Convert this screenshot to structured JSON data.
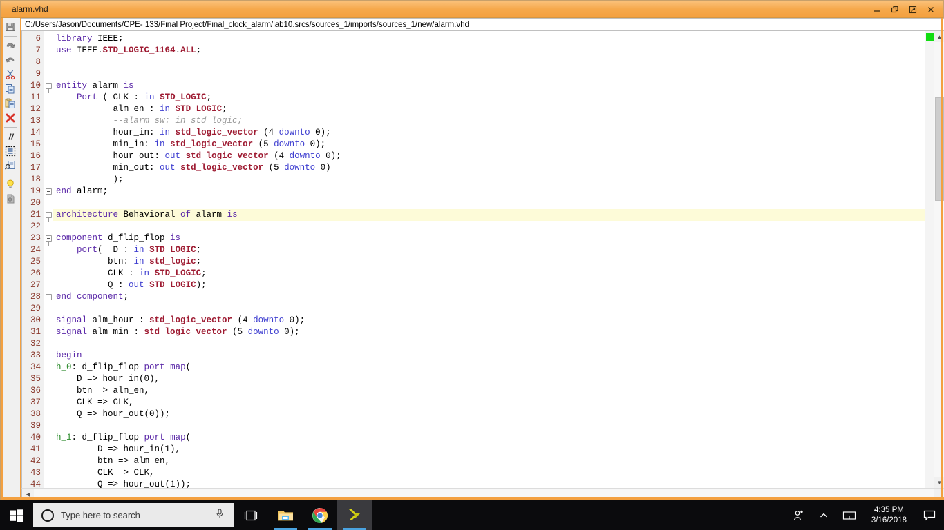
{
  "window": {
    "tab_title": "alarm.vhd",
    "file_path": "C:/Users/Jason/Documents/CPE- 133/Final Project/Final_clock_alarm/lab10.srcs/sources_1/imports/sources_1/new/alarm.vhd",
    "controls": {
      "minimize": "minimize-icon",
      "restore": "restore-icon",
      "float": "float-icon",
      "close": "close-icon"
    },
    "accent_color": "#f3a040",
    "titlebar_color": "#f6a94c"
  },
  "left_toolbar": {
    "items": [
      {
        "name": "save-icon",
        "title": "Save File"
      },
      {
        "name": "undo-icon",
        "title": "Undo"
      },
      {
        "name": "redo-icon",
        "title": "Redo"
      },
      {
        "name": "cut-icon",
        "title": "Cut"
      },
      {
        "name": "copy-icon",
        "title": "Copy"
      },
      {
        "name": "paste-icon",
        "title": "Paste"
      },
      {
        "name": "delete-x-icon",
        "title": "Delete"
      },
      {
        "name": "comment-slashes-icon",
        "title": "Toggle Comment"
      },
      {
        "name": "select-block-icon",
        "title": "Select Block"
      },
      {
        "name": "find-replace-icon",
        "title": "Find / Replace"
      },
      {
        "name": "lightbulb-icon",
        "title": "Suggestions"
      },
      {
        "name": "unknown-tool-icon",
        "title": "More"
      }
    ]
  },
  "editor": {
    "current_line": 21,
    "first_visible_line": 6,
    "colors": {
      "keyword": "#5b29a8",
      "type": "#9e1b32",
      "direction": "#3f3fd0",
      "comment": "#9a9a9a",
      "label": "#2c8b2c",
      "line_number": "#8b3a2e",
      "current_line_bg": "#fdfbd8",
      "marker_green": "#11dd11"
    },
    "lines": [
      {
        "n": 6,
        "fold": null,
        "tokens": [
          {
            "t": "library",
            "c": "kw"
          },
          {
            "t": " IEEE;",
            "c": "pl"
          }
        ]
      },
      {
        "n": 7,
        "fold": null,
        "tokens": [
          {
            "t": "use",
            "c": "kw"
          },
          {
            "t": " IEEE.",
            "c": "pl"
          },
          {
            "t": "STD_LOGIC_1164",
            "c": "typ"
          },
          {
            "t": ".",
            "c": "pl"
          },
          {
            "t": "ALL",
            "c": "typ"
          },
          {
            "t": ";",
            "c": "pl"
          }
        ]
      },
      {
        "n": 8,
        "fold": null,
        "tokens": []
      },
      {
        "n": 9,
        "fold": null,
        "tokens": []
      },
      {
        "n": 10,
        "fold": "open",
        "tokens": [
          {
            "t": "entity",
            "c": "kw"
          },
          {
            "t": " alarm ",
            "c": "pl"
          },
          {
            "t": "is",
            "c": "kw"
          }
        ]
      },
      {
        "n": 11,
        "fold": null,
        "tokens": [
          {
            "t": "    ",
            "c": "pl"
          },
          {
            "t": "Port",
            "c": "kw"
          },
          {
            "t": " ( CLK : ",
            "c": "pl"
          },
          {
            "t": "in",
            "c": "dir"
          },
          {
            "t": " ",
            "c": "pl"
          },
          {
            "t": "STD_LOGIC",
            "c": "typ"
          },
          {
            "t": ";",
            "c": "pl"
          }
        ]
      },
      {
        "n": 12,
        "fold": null,
        "tokens": [
          {
            "t": "           alm_en : ",
            "c": "pl"
          },
          {
            "t": "in",
            "c": "dir"
          },
          {
            "t": " ",
            "c": "pl"
          },
          {
            "t": "STD_LOGIC",
            "c": "typ"
          },
          {
            "t": ";",
            "c": "pl"
          }
        ]
      },
      {
        "n": 13,
        "fold": null,
        "tokens": [
          {
            "t": "           --alarm_sw: in std_logic;",
            "c": "cmt"
          }
        ]
      },
      {
        "n": 14,
        "fold": null,
        "tokens": [
          {
            "t": "           hour_in: ",
            "c": "pl"
          },
          {
            "t": "in",
            "c": "dir"
          },
          {
            "t": " ",
            "c": "pl"
          },
          {
            "t": "std_logic_vector",
            "c": "typ"
          },
          {
            "t": " (4 ",
            "c": "pl"
          },
          {
            "t": "downto",
            "c": "dir"
          },
          {
            "t": " 0);",
            "c": "pl"
          }
        ]
      },
      {
        "n": 15,
        "fold": null,
        "tokens": [
          {
            "t": "           min_in: ",
            "c": "pl"
          },
          {
            "t": "in",
            "c": "dir"
          },
          {
            "t": " ",
            "c": "pl"
          },
          {
            "t": "std_logic_vector",
            "c": "typ"
          },
          {
            "t": " (5 ",
            "c": "pl"
          },
          {
            "t": "downto",
            "c": "dir"
          },
          {
            "t": " 0);",
            "c": "pl"
          }
        ]
      },
      {
        "n": 16,
        "fold": null,
        "tokens": [
          {
            "t": "           hour_out: ",
            "c": "pl"
          },
          {
            "t": "out",
            "c": "dir"
          },
          {
            "t": " ",
            "c": "pl"
          },
          {
            "t": "std_logic_vector",
            "c": "typ"
          },
          {
            "t": " (4 ",
            "c": "pl"
          },
          {
            "t": "downto",
            "c": "dir"
          },
          {
            "t": " 0);",
            "c": "pl"
          }
        ]
      },
      {
        "n": 17,
        "fold": null,
        "tokens": [
          {
            "t": "           min_out: ",
            "c": "pl"
          },
          {
            "t": "out",
            "c": "dir"
          },
          {
            "t": " ",
            "c": "pl"
          },
          {
            "t": "std_logic_vector",
            "c": "typ"
          },
          {
            "t": " (5 ",
            "c": "pl"
          },
          {
            "t": "downto",
            "c": "dir"
          },
          {
            "t": " 0)",
            "c": "pl"
          }
        ]
      },
      {
        "n": 18,
        "fold": null,
        "tokens": [
          {
            "t": "           );",
            "c": "pl"
          }
        ]
      },
      {
        "n": 19,
        "fold": "close",
        "tokens": [
          {
            "t": "end",
            "c": "kw"
          },
          {
            "t": " alarm;",
            "c": "pl"
          }
        ]
      },
      {
        "n": 20,
        "fold": null,
        "tokens": []
      },
      {
        "n": 21,
        "fold": "open",
        "tokens": [
          {
            "t": "architecture",
            "c": "kw"
          },
          {
            "t": " Behavioral ",
            "c": "pl"
          },
          {
            "t": "of",
            "c": "kw"
          },
          {
            "t": " alarm ",
            "c": "pl"
          },
          {
            "t": "is",
            "c": "kw"
          }
        ]
      },
      {
        "n": 22,
        "fold": null,
        "tokens": []
      },
      {
        "n": 23,
        "fold": "open",
        "tokens": [
          {
            "t": "component",
            "c": "kw"
          },
          {
            "t": " d_flip_flop ",
            "c": "pl"
          },
          {
            "t": "is",
            "c": "kw"
          }
        ]
      },
      {
        "n": 24,
        "fold": null,
        "tokens": [
          {
            "t": "    ",
            "c": "pl"
          },
          {
            "t": "port",
            "c": "kw"
          },
          {
            "t": "(  D : ",
            "c": "pl"
          },
          {
            "t": "in",
            "c": "dir"
          },
          {
            "t": " ",
            "c": "pl"
          },
          {
            "t": "STD_LOGIC",
            "c": "typ"
          },
          {
            "t": ";",
            "c": "pl"
          }
        ]
      },
      {
        "n": 25,
        "fold": null,
        "tokens": [
          {
            "t": "          btn: ",
            "c": "pl"
          },
          {
            "t": "in",
            "c": "dir"
          },
          {
            "t": " ",
            "c": "pl"
          },
          {
            "t": "std_logic",
            "c": "typ"
          },
          {
            "t": ";",
            "c": "pl"
          }
        ]
      },
      {
        "n": 26,
        "fold": null,
        "tokens": [
          {
            "t": "          CLK : ",
            "c": "pl"
          },
          {
            "t": "in",
            "c": "dir"
          },
          {
            "t": " ",
            "c": "pl"
          },
          {
            "t": "STD_LOGIC",
            "c": "typ"
          },
          {
            "t": ";",
            "c": "pl"
          }
        ]
      },
      {
        "n": 27,
        "fold": null,
        "tokens": [
          {
            "t": "          Q : ",
            "c": "pl"
          },
          {
            "t": "out",
            "c": "dir"
          },
          {
            "t": " ",
            "c": "pl"
          },
          {
            "t": "STD_LOGIC",
            "c": "typ"
          },
          {
            "t": ");",
            "c": "pl"
          }
        ]
      },
      {
        "n": 28,
        "fold": "close",
        "tokens": [
          {
            "t": "end",
            "c": "kw"
          },
          {
            "t": " ",
            "c": "pl"
          },
          {
            "t": "component",
            "c": "kw"
          },
          {
            "t": ";",
            "c": "pl"
          }
        ]
      },
      {
        "n": 29,
        "fold": null,
        "tokens": []
      },
      {
        "n": 30,
        "fold": null,
        "tokens": [
          {
            "t": "signal",
            "c": "kw"
          },
          {
            "t": " alm_hour : ",
            "c": "pl"
          },
          {
            "t": "std_logic_vector",
            "c": "typ"
          },
          {
            "t": " (4 ",
            "c": "pl"
          },
          {
            "t": "downto",
            "c": "dir"
          },
          {
            "t": " 0);",
            "c": "pl"
          }
        ]
      },
      {
        "n": 31,
        "fold": null,
        "tokens": [
          {
            "t": "signal",
            "c": "kw"
          },
          {
            "t": " alm_min : ",
            "c": "pl"
          },
          {
            "t": "std_logic_vector",
            "c": "typ"
          },
          {
            "t": " (5 ",
            "c": "pl"
          },
          {
            "t": "downto",
            "c": "dir"
          },
          {
            "t": " 0);",
            "c": "pl"
          }
        ]
      },
      {
        "n": 32,
        "fold": null,
        "tokens": []
      },
      {
        "n": 33,
        "fold": null,
        "tokens": [
          {
            "t": "begin",
            "c": "kw"
          }
        ]
      },
      {
        "n": 34,
        "fold": null,
        "tokens": [
          {
            "t": "h_0",
            "c": "lbl"
          },
          {
            "t": ": d_flip_flop ",
            "c": "pl"
          },
          {
            "t": "port",
            "c": "kw"
          },
          {
            "t": " ",
            "c": "pl"
          },
          {
            "t": "map",
            "c": "kw"
          },
          {
            "t": "(",
            "c": "pl"
          }
        ]
      },
      {
        "n": 35,
        "fold": null,
        "tokens": [
          {
            "t": "    D => hour_in(0),",
            "c": "pl"
          }
        ]
      },
      {
        "n": 36,
        "fold": null,
        "tokens": [
          {
            "t": "    btn => alm_en,",
            "c": "pl"
          }
        ]
      },
      {
        "n": 37,
        "fold": null,
        "tokens": [
          {
            "t": "    CLK => CLK,",
            "c": "pl"
          }
        ]
      },
      {
        "n": 38,
        "fold": null,
        "tokens": [
          {
            "t": "    Q => hour_out(0));",
            "c": "pl"
          }
        ]
      },
      {
        "n": 39,
        "fold": null,
        "tokens": []
      },
      {
        "n": 40,
        "fold": null,
        "tokens": [
          {
            "t": "h_1",
            "c": "lbl"
          },
          {
            "t": ": d_flip_flop ",
            "c": "pl"
          },
          {
            "t": "port",
            "c": "kw"
          },
          {
            "t": " ",
            "c": "pl"
          },
          {
            "t": "map",
            "c": "kw"
          },
          {
            "t": "(",
            "c": "pl"
          }
        ]
      },
      {
        "n": 41,
        "fold": null,
        "tokens": [
          {
            "t": "        D => hour_in(1),",
            "c": "pl"
          }
        ]
      },
      {
        "n": 42,
        "fold": null,
        "tokens": [
          {
            "t": "        btn => alm_en,",
            "c": "pl"
          }
        ]
      },
      {
        "n": 43,
        "fold": null,
        "tokens": [
          {
            "t": "        CLK => CLK,",
            "c": "pl"
          }
        ]
      },
      {
        "n": 44,
        "fold": null,
        "tokens": [
          {
            "t": "        Q => hour_out(1));",
            "c": "pl"
          }
        ]
      }
    ]
  },
  "taskbar": {
    "start": "windows-start-icon",
    "search_placeholder": "Type here to search",
    "cortana": "cortana-circle-icon",
    "mic": "microphone-icon",
    "apps": [
      {
        "name": "task-view-icon",
        "label": "Task View",
        "running": false,
        "active": false
      },
      {
        "name": "file-explorer-icon",
        "label": "File Explorer",
        "running": true,
        "active": false
      },
      {
        "name": "google-chrome-icon",
        "label": "Google Chrome",
        "running": true,
        "active": false
      },
      {
        "name": "vivado-icon",
        "label": "Vivado",
        "running": true,
        "active": true
      }
    ],
    "tray": {
      "people": "people-icon",
      "show_hidden": "show-hidden-icons-chevron",
      "touch_keyboard": "touch-keyboard-icon",
      "time": "4:35 PM",
      "date": "3/16/2018",
      "action_center": "action-center-icon"
    }
  }
}
